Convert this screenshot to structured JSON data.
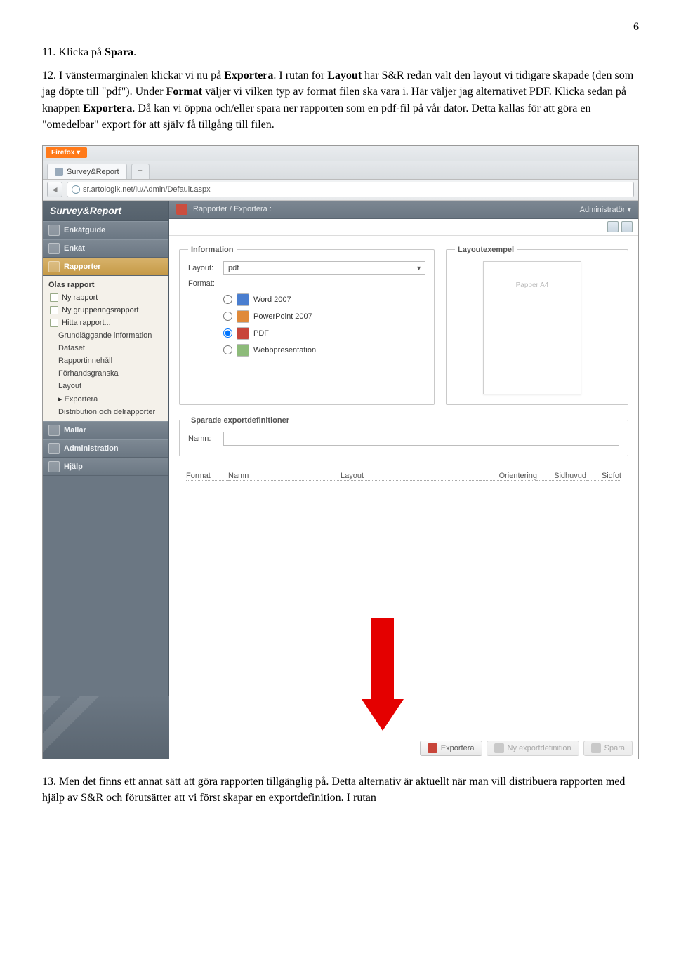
{
  "pageNumber": "6",
  "instructions": {
    "item11": {
      "num": "11.",
      "text1": " Klicka på ",
      "bold": "Spara",
      "text2": "."
    },
    "item12": {
      "num": "12.",
      "text1": " I vänstermarginalen klickar vi nu på ",
      "bold1": "Exportera",
      "text2": ". I rutan för ",
      "bold2": "Layout",
      "text3": " har S&R redan valt den layout vi tidigare skapade (den som jag döpte till \"pdf\"). Under ",
      "bold3": "Format",
      "text4": " väljer vi vilken typ av format filen ska vara i. Här väljer jag alternativet PDF. Klicka sedan på knappen ",
      "bold4": "Exportera",
      "text5": ". Då kan vi öppna och/eller spara ner rapporten som en pdf-fil på vår dator. Detta kallas för att göra en \"omedelbar\" export för att själv få tillgång till filen."
    },
    "item13": {
      "num": "13.",
      "text": " Men det finns ett annat sätt att göra rapporten tillgänglig på. Detta alternativ är aktuellt när man vill distribuera rapporten med hjälp av S&R och förutsätter att vi först skapar en exportdefinition. I rutan"
    }
  },
  "firefox": {
    "brand": "Firefox",
    "tabTitle": "Survey&Report",
    "plus": "+",
    "url": "sr.artologik.net/lu/Admin/Default.aspx"
  },
  "sidebar": {
    "brand": "Survey&Report",
    "nav": {
      "enkatguide": "Enkätguide",
      "enkat": "Enkät",
      "rapporter": "Rapporter",
      "mallar": "Mallar",
      "administration": "Administration",
      "hjalp": "Hjälp"
    },
    "rapportSub": {
      "header": "Olas rapport",
      "nyRapport": "Ny rapport",
      "nyGrupp": "Ny grupperingsrapport",
      "hitta": "Hitta rapport...",
      "grund": "Grundläggande information",
      "dataset": "Dataset",
      "innehall": "Rapportinnehåll",
      "forhands": "Förhandsgranska",
      "layout": "Layout",
      "exportera": "Exportera",
      "distribution": "Distribution och delrapporter"
    }
  },
  "breadcrumb": {
    "text": "Rapporter / Exportera :",
    "user": "Administratör"
  },
  "content": {
    "infoLegend": "Information",
    "layoutExLegend": "Layoutexempel",
    "layoutLabel": "Layout:",
    "layoutValue": "pdf",
    "formatLabel": "Format:",
    "formats": {
      "word": "Word 2007",
      "ppt": "PowerPoint 2007",
      "pdf": "PDF",
      "web": "Webbpresentation"
    },
    "paperLabel": "Papper A4",
    "savedLegend": "Sparade exportdefinitioner",
    "namnLabel": "Namn:",
    "columns": {
      "format": "Format",
      "namn": "Namn",
      "layout": "Layout",
      "orient": "Orientering",
      "sidhuvud": "Sidhuvud",
      "sidfot": "Sidfot"
    }
  },
  "toolbar": {
    "exportera": "Exportera",
    "nyDef": "Ny exportdefinition",
    "spara": "Spara"
  }
}
